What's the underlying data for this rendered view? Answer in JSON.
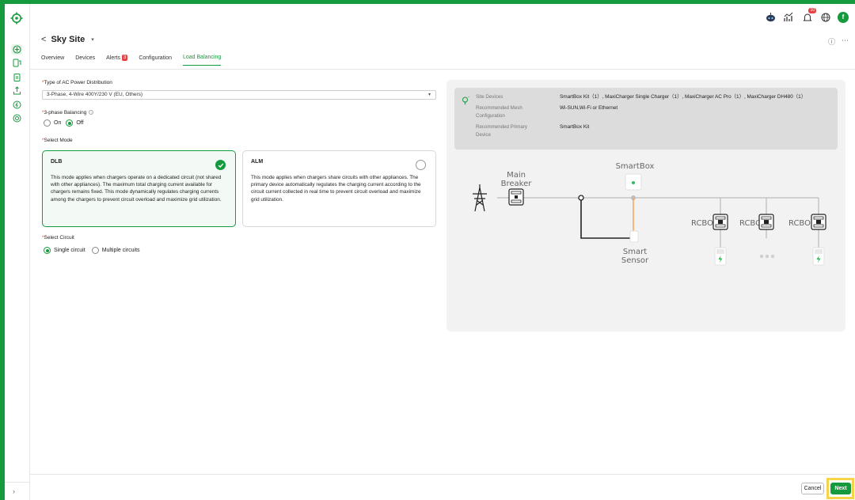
{
  "app": {
    "site_name": "Sky Site",
    "back_label": "<",
    "caret": "▾",
    "notification_count": "10",
    "avatar_initial": "f"
  },
  "tabs": [
    {
      "label": "Overview"
    },
    {
      "label": "Devices"
    },
    {
      "label": "Alerts",
      "count": "3"
    },
    {
      "label": "Configuration"
    },
    {
      "label": "Load Balancing"
    }
  ],
  "form": {
    "ac_label": "Type of AC Power Distribution",
    "ac_value": "3-Phase, 4-Wire 400Y/230 V (EU, Others)",
    "balancing_label": "3-phase Balancing",
    "on_label": "On",
    "off_label": "Off",
    "mode_label": "Select Mode",
    "circuit_label": "Select Circuit",
    "single_label": "Single circuit",
    "multiple_label": "Multiple circuits"
  },
  "modes": [
    {
      "title": "DLB",
      "desc": "This mode applies when chargers operate on a dedicated circuit (not shared with other appliances). The maximum total charging current available for chargers remains fixed. This mode dynamically regulates charging currents among the chargers to prevent circuit overload and maximize grid utilization."
    },
    {
      "title": "ALM",
      "desc": "This mode applies when chargers share circuits with other appliances. The primary device automatically regulates the charging current according to the circuit current collected in real time to prevent circuit overload and maximize grid utilization."
    }
  ],
  "info": {
    "site_devices_label": "Site Devices",
    "site_devices_value": "SmartBox Kit（1）, MaxiCharger Single Charger（1）, MaxiCharger AC Pro（1）, MaxiCharger DH480（1）",
    "mesh_label_1": "Recommended Mesh",
    "mesh_label_2": "Configuration",
    "mesh_value": "Wi-SUN,Wi-Fi or Ethernet",
    "primary_label_1": "Recommended Primary",
    "primary_label_2": "Device",
    "primary_value": "SmartBox Kit"
  },
  "diagram": {
    "main_breaker_1": "Main",
    "main_breaker_2": "Breaker",
    "smartbox": "SmartBox",
    "smart_sensor_1": "Smart",
    "smart_sensor_2": "Sensor",
    "rcbo": "RCBO"
  },
  "footer": {
    "cancel": "Cancel",
    "next": "Next"
  },
  "colors": {
    "brand": "#159a3e",
    "alert": "#e94141",
    "sensor_line": "#f2a55a"
  }
}
